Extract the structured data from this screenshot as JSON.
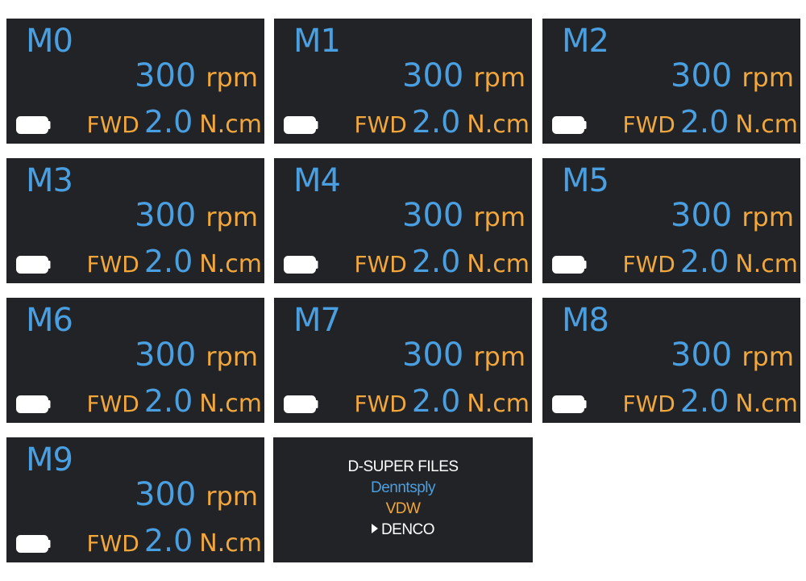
{
  "screens": [
    {
      "mode": "M0",
      "speed": "300",
      "speed_unit": "rpm",
      "direction": "FWD",
      "torque": "2.0",
      "torque_unit": "N.cm",
      "battery_icon": "battery-icon"
    },
    {
      "mode": "M1",
      "speed": "300",
      "speed_unit": "rpm",
      "direction": "FWD",
      "torque": "2.0",
      "torque_unit": "N.cm",
      "battery_icon": "battery-icon"
    },
    {
      "mode": "M2",
      "speed": "300",
      "speed_unit": "rpm",
      "direction": "FWD",
      "torque": "2.0",
      "torque_unit": "N.cm",
      "battery_icon": "battery-icon"
    },
    {
      "mode": "M3",
      "speed": "300",
      "speed_unit": "rpm",
      "direction": "FWD",
      "torque": "2.0",
      "torque_unit": "N.cm",
      "battery_icon": "battery-icon"
    },
    {
      "mode": "M4",
      "speed": "300",
      "speed_unit": "rpm",
      "direction": "FWD",
      "torque": "2.0",
      "torque_unit": "N.cm",
      "battery_icon": "battery-icon"
    },
    {
      "mode": "M5",
      "speed": "300",
      "speed_unit": "rpm",
      "direction": "FWD",
      "torque": "2.0",
      "torque_unit": "N.cm",
      "battery_icon": "battery-icon"
    },
    {
      "mode": "M6",
      "speed": "300",
      "speed_unit": "rpm",
      "direction": "FWD",
      "torque": "2.0",
      "torque_unit": "N.cm",
      "battery_icon": "battery-icon"
    },
    {
      "mode": "M7",
      "speed": "300",
      "speed_unit": "rpm",
      "direction": "FWD",
      "torque": "2.0",
      "torque_unit": "N.cm",
      "battery_icon": "battery-icon"
    },
    {
      "mode": "M8",
      "speed": "300",
      "speed_unit": "rpm",
      "direction": "FWD",
      "torque": "2.0",
      "torque_unit": "N.cm",
      "battery_icon": "battery-icon"
    },
    {
      "mode": "M9",
      "speed": "300",
      "speed_unit": "rpm",
      "direction": "FWD",
      "torque": "2.0",
      "torque_unit": "N.cm",
      "battery_icon": "battery-icon"
    }
  ],
  "menu": {
    "title": "D-SUPER FILES",
    "items": [
      "Denntsply",
      "VDW",
      "DENCO"
    ],
    "selected_indicator_icon": "triangle-right-icon"
  },
  "colors": {
    "screen_bg": "#222327",
    "value_blue": "#4a9fe0",
    "unit_gold": "#f1a73b",
    "text_white": "#ffffff"
  }
}
